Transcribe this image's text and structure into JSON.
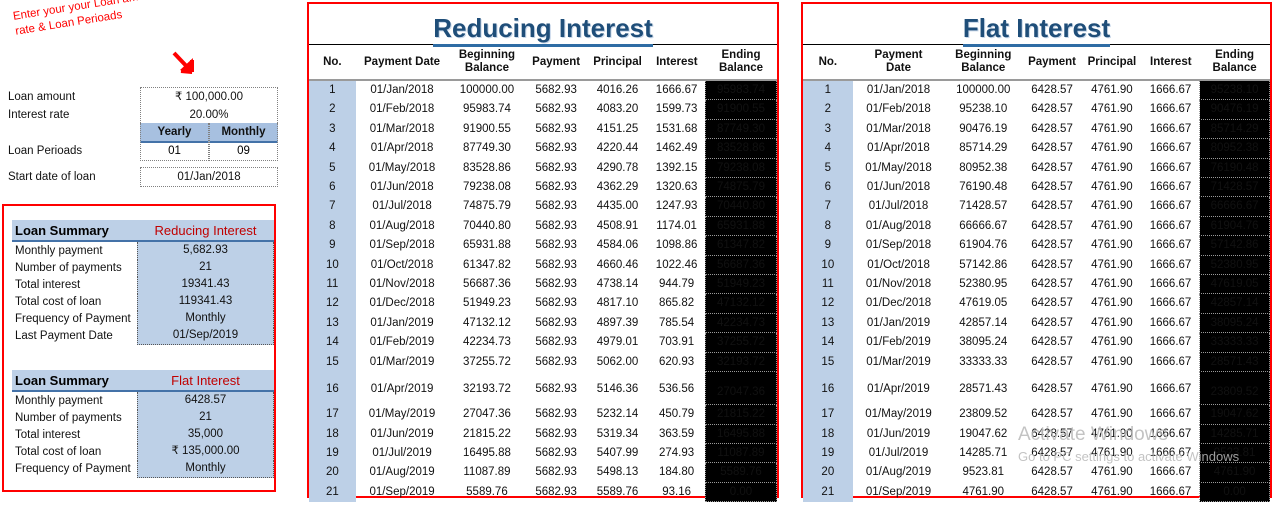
{
  "annotation": {
    "text": "Enter your your Loan amount , interest rate & Loan Perioads",
    "color": "#ff0000",
    "arrow": "down-right-arrow"
  },
  "inputs": {
    "loan_amount": {
      "label": "Loan amount",
      "value": "₹ 100,000.00"
    },
    "interest_rate": {
      "label": "Interest rate",
      "value": "20.00%"
    },
    "loan_periods": {
      "label": "Loan Perioads",
      "yearly_header": "Yearly",
      "monthly_header": "Monthly",
      "yearly_value": "01",
      "monthly_value": "09"
    },
    "start_date": {
      "label": "Start date of loan",
      "value": "01/Jan/2018"
    }
  },
  "summaries": [
    {
      "title": "Loan Summary",
      "kind": "Reducing Interest",
      "rows": [
        {
          "label": "Monthly payment",
          "value": "5,682.93"
        },
        {
          "label": "Number of payments",
          "value": "21"
        },
        {
          "label": "Total interest",
          "value": "19341.43"
        },
        {
          "label": "Total cost of loan",
          "value": "119341.43"
        },
        {
          "label": "Frequency of Payment",
          "value": "Monthly"
        },
        {
          "label": "Last Payment Date",
          "value": "01/Sep/2019"
        }
      ]
    },
    {
      "title": "Loan Summary",
      "kind": "Flat Interest",
      "rows": [
        {
          "label": "Monthly payment",
          "value": "6428.57"
        },
        {
          "label": "Number of payments",
          "value": "21"
        },
        {
          "label": "Total interest",
          "value": "35,000"
        },
        {
          "label": "Total cost of loan",
          "value": "₹ 135,000.00"
        },
        {
          "label": "Frequency of Payment",
          "value": "Monthly"
        }
      ]
    }
  ],
  "reducing": {
    "title": "Reducing Interest",
    "headers": [
      "No.",
      "Payment Date",
      "Beginning\nBalance",
      "Payment",
      "Principal",
      "Interest",
      "Ending\nBalance"
    ],
    "rows": [
      [
        "1",
        "01/Jan/2018",
        "100000.00",
        "5682.93",
        "4016.26",
        "1666.67",
        "95983.74"
      ],
      [
        "2",
        "01/Feb/2018",
        "95983.74",
        "5682.93",
        "4083.20",
        "1599.73",
        "91900.55"
      ],
      [
        "3",
        "01/Mar/2018",
        "91900.55",
        "5682.93",
        "4151.25",
        "1531.68",
        "87749.30"
      ],
      [
        "4",
        "01/Apr/2018",
        "87749.30",
        "5682.93",
        "4220.44",
        "1462.49",
        "83528.86"
      ],
      [
        "5",
        "01/May/2018",
        "83528.86",
        "5682.93",
        "4290.78",
        "1392.15",
        "79238.08"
      ],
      [
        "6",
        "01/Jun/2018",
        "79238.08",
        "5682.93",
        "4362.29",
        "1320.63",
        "74875.79"
      ],
      [
        "7",
        "01/Jul/2018",
        "74875.79",
        "5682.93",
        "4435.00",
        "1247.93",
        "70440.80"
      ],
      [
        "8",
        "01/Aug/2018",
        "70440.80",
        "5682.93",
        "4508.91",
        "1174.01",
        "65931.88"
      ],
      [
        "9",
        "01/Sep/2018",
        "65931.88",
        "5682.93",
        "4584.06",
        "1098.86",
        "61347.82"
      ],
      [
        "10",
        "01/Oct/2018",
        "61347.82",
        "5682.93",
        "4660.46",
        "1022.46",
        "56687.36"
      ],
      [
        "11",
        "01/Nov/2018",
        "56687.36",
        "5682.93",
        "4738.14",
        "944.79",
        "51949.23"
      ],
      [
        "12",
        "01/Dec/2018",
        "51949.23",
        "5682.93",
        "4817.10",
        "865.82",
        "47132.12"
      ],
      [
        "13",
        "01/Jan/2019",
        "47132.12",
        "5682.93",
        "4897.39",
        "785.54",
        "42234.73"
      ],
      [
        "14",
        "01/Feb/2019",
        "42234.73",
        "5682.93",
        "4979.01",
        "703.91",
        "37255.72"
      ],
      [
        "15",
        "01/Mar/2019",
        "37255.72",
        "5682.93",
        "5062.00",
        "620.93",
        "32193.72"
      ],
      [
        "16",
        "01/Apr/2019",
        "32193.72",
        "5682.93",
        "5146.36",
        "536.56",
        "27047.36"
      ],
      [
        "17",
        "01/May/2019",
        "27047.36",
        "5682.93",
        "5232.14",
        "450.79",
        "21815.22"
      ],
      [
        "18",
        "01/Jun/2019",
        "21815.22",
        "5682.93",
        "5319.34",
        "363.59",
        "16495.88"
      ],
      [
        "19",
        "01/Jul/2019",
        "16495.88",
        "5682.93",
        "5407.99",
        "274.93",
        "11087.89"
      ],
      [
        "20",
        "01/Aug/2019",
        "11087.89",
        "5682.93",
        "5498.13",
        "184.80",
        "5589.76"
      ],
      [
        "21",
        "01/Sep/2019",
        "5589.76",
        "5682.93",
        "5589.76",
        "93.16",
        "0.00"
      ]
    ]
  },
  "flat": {
    "title": "Flat Interest",
    "headers": [
      "No.",
      "Payment\nDate",
      "Beginning\nBalance",
      "Payment",
      "Principal",
      "Interest",
      "Ending\nBalance"
    ],
    "rows": [
      [
        "1",
        "01/Jan/2018",
        "100000.00",
        "6428.57",
        "4761.90",
        "1666.67",
        "95238.10"
      ],
      [
        "2",
        "01/Feb/2018",
        "95238.10",
        "6428.57",
        "4761.90",
        "1666.67",
        "90476.19"
      ],
      [
        "3",
        "01/Mar/2018",
        "90476.19",
        "6428.57",
        "4761.90",
        "1666.67",
        "85714.29"
      ],
      [
        "4",
        "01/Apr/2018",
        "85714.29",
        "6428.57",
        "4761.90",
        "1666.67",
        "80952.38"
      ],
      [
        "5",
        "01/May/2018",
        "80952.38",
        "6428.57",
        "4761.90",
        "1666.67",
        "76190.48"
      ],
      [
        "6",
        "01/Jun/2018",
        "76190.48",
        "6428.57",
        "4761.90",
        "1666.67",
        "71428.57"
      ],
      [
        "7",
        "01/Jul/2018",
        "71428.57",
        "6428.57",
        "4761.90",
        "1666.67",
        "66666.67"
      ],
      [
        "8",
        "01/Aug/2018",
        "66666.67",
        "6428.57",
        "4761.90",
        "1666.67",
        "61904.76"
      ],
      [
        "9",
        "01/Sep/2018",
        "61904.76",
        "6428.57",
        "4761.90",
        "1666.67",
        "57142.86"
      ],
      [
        "10",
        "01/Oct/2018",
        "57142.86",
        "6428.57",
        "4761.90",
        "1666.67",
        "52380.95"
      ],
      [
        "11",
        "01/Nov/2018",
        "52380.95",
        "6428.57",
        "4761.90",
        "1666.67",
        "47619.05"
      ],
      [
        "12",
        "01/Dec/2018",
        "47619.05",
        "6428.57",
        "4761.90",
        "1666.67",
        "42857.14"
      ],
      [
        "13",
        "01/Jan/2019",
        "42857.14",
        "6428.57",
        "4761.90",
        "1666.67",
        "38095.24"
      ],
      [
        "14",
        "01/Feb/2019",
        "38095.24",
        "6428.57",
        "4761.90",
        "1666.67",
        "33333.33"
      ],
      [
        "15",
        "01/Mar/2019",
        "33333.33",
        "6428.57",
        "4761.90",
        "1666.67",
        "28571.43"
      ],
      [
        "16",
        "01/Apr/2019",
        "28571.43",
        "6428.57",
        "4761.90",
        "1666.67",
        "23809.52"
      ],
      [
        "17",
        "01/May/2019",
        "23809.52",
        "6428.57",
        "4761.90",
        "1666.67",
        "19047.62"
      ],
      [
        "18",
        "01/Jun/2019",
        "19047.62",
        "6428.57",
        "4761.90",
        "1666.67",
        "14285.71"
      ],
      [
        "19",
        "01/Jul/2019",
        "14285.71",
        "6428.57",
        "4761.90",
        "1666.67",
        "9523.81"
      ],
      [
        "20",
        "01/Aug/2019",
        "9523.81",
        "6428.57",
        "4761.90",
        "1666.67",
        "4761.90"
      ],
      [
        "21",
        "01/Sep/2019",
        "4761.90",
        "6428.57",
        "4761.90",
        "1666.67",
        "0.00"
      ]
    ]
  },
  "watermark": {
    "line1": "Activate Windows",
    "line2": "Go to PC settings to activate Windows"
  },
  "colors": {
    "title_blue": "#1f4e79",
    "accent_red": "#ff0000",
    "summary_label_red": "#c00000",
    "row_no_blue": "#bdd0e7",
    "header_blue": "#a7c0e0",
    "ending_bg": "#000000"
  }
}
